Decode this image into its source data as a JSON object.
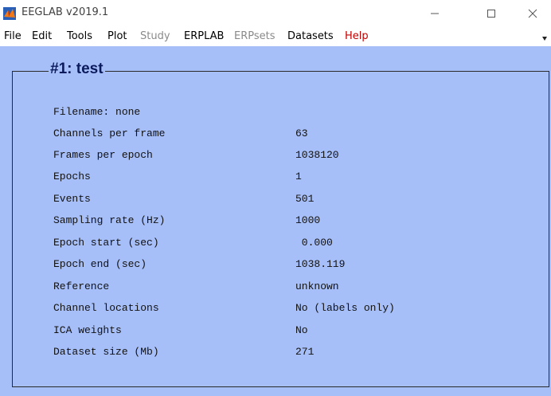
{
  "window": {
    "title": "EEGLAB v2019.1"
  },
  "menu": {
    "items": [
      {
        "label": "File"
      },
      {
        "label": "Edit"
      },
      {
        "label": "Tools"
      },
      {
        "label": "Plot"
      },
      {
        "label": "Study"
      },
      {
        "label": "ERPLAB"
      },
      {
        "label": "ERPsets"
      },
      {
        "label": "Datasets"
      },
      {
        "label": "Help"
      }
    ]
  },
  "panel": {
    "title": "#1: test",
    "filename_line": "Filename: none",
    "rows": [
      {
        "label": "Channels per frame",
        "value": "63"
      },
      {
        "label": "Frames per epoch",
        "value": "1038120"
      },
      {
        "label": "Epochs",
        "value": "1"
      },
      {
        "label": "Events",
        "value": "501"
      },
      {
        "label": "Sampling rate (Hz)",
        "value": "1000"
      },
      {
        "label": "Epoch start (sec)",
        "value": " 0.000"
      },
      {
        "label": "Epoch end (sec)",
        "value": "1038.119"
      },
      {
        "label": "Reference",
        "value": "unknown"
      },
      {
        "label": "Channel locations",
        "value": "No (labels only)"
      },
      {
        "label": "ICA weights",
        "value": "No"
      },
      {
        "label": "Dataset size (Mb)",
        "value": "271"
      }
    ]
  },
  "colors": {
    "background": "#a7bff8",
    "title_text": "#0b1a5c",
    "help_menu": "#c00000",
    "disabled_menu": "#8a8a8a"
  },
  "icons": {
    "app": "matlab-logo-icon",
    "minimize": "minimize-icon",
    "maximize": "maximize-icon",
    "close": "close-icon",
    "menu_overflow": "overflow-arrow-icon"
  }
}
